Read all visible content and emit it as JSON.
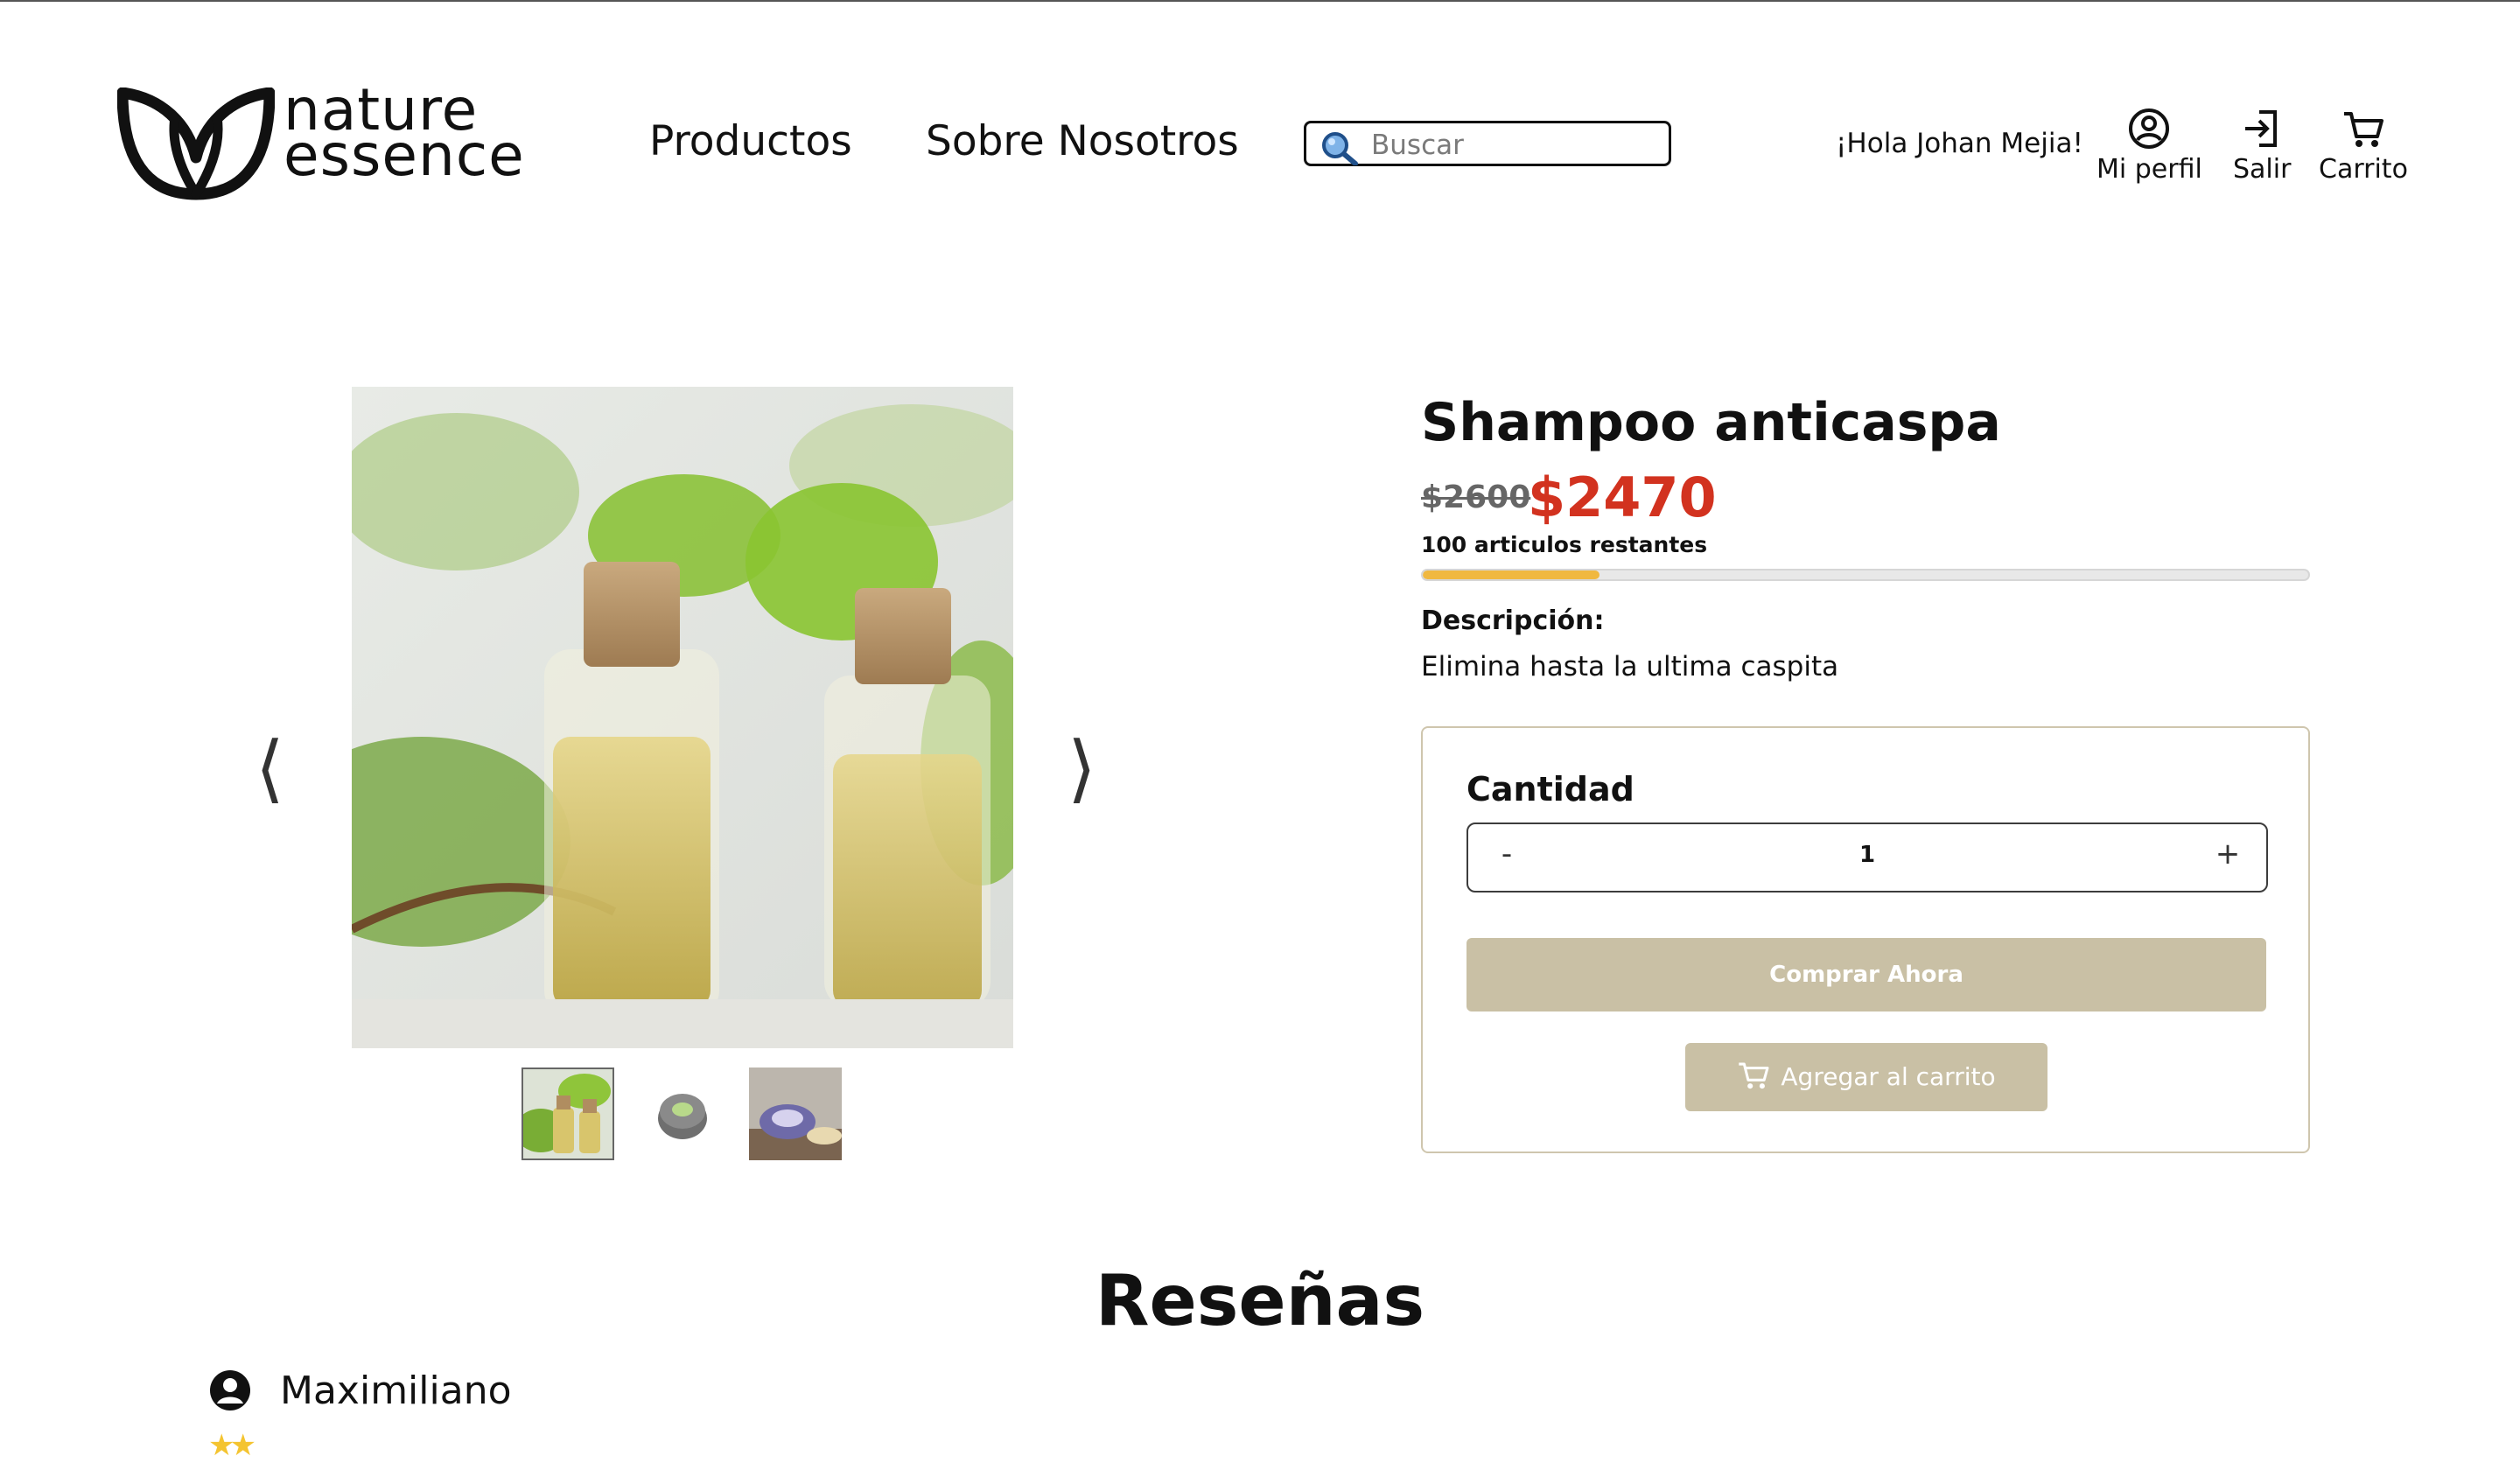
{
  "header": {
    "brand": {
      "line1": "nature",
      "line2": "essence"
    },
    "nav": [
      {
        "label": "Productos"
      },
      {
        "label": "Sobre Nosotros"
      }
    ],
    "search": {
      "placeholder": "Buscar",
      "icon": "magnifier-icon"
    },
    "greeting": "¡Hola Johan Mejia!",
    "actions": {
      "profile": "Mi perfil",
      "logout": "Salir",
      "cart": "Carrito"
    }
  },
  "gallery": {
    "thumbnails": [
      "oil-bottles",
      "round-tin-green",
      "round-tin-purple"
    ],
    "selected_index": 0
  },
  "product": {
    "title": "Shampoo anticaspa",
    "old_price": "$2600",
    "price": "$2470",
    "stock_text": "100 articulos restantes",
    "stock_fraction": 0.2,
    "description_label": "Descripción:",
    "description": "Elimina hasta la ultima caspita",
    "quantity_label": "Cantidad",
    "quantity_value": "1",
    "decrement": "-",
    "increment": "+",
    "buy_label": "Comprar Ahora",
    "cart_label": "Agregar al carrito"
  },
  "reviews": {
    "heading": "Reseñas",
    "items": [
      {
        "author": "Maximiliano",
        "rating": 2
      }
    ]
  },
  "colors": {
    "accent_button": "#c9c0a5",
    "price_red": "#d2321f",
    "stock_bar": "#f0b840",
    "star": "#f4c430"
  }
}
